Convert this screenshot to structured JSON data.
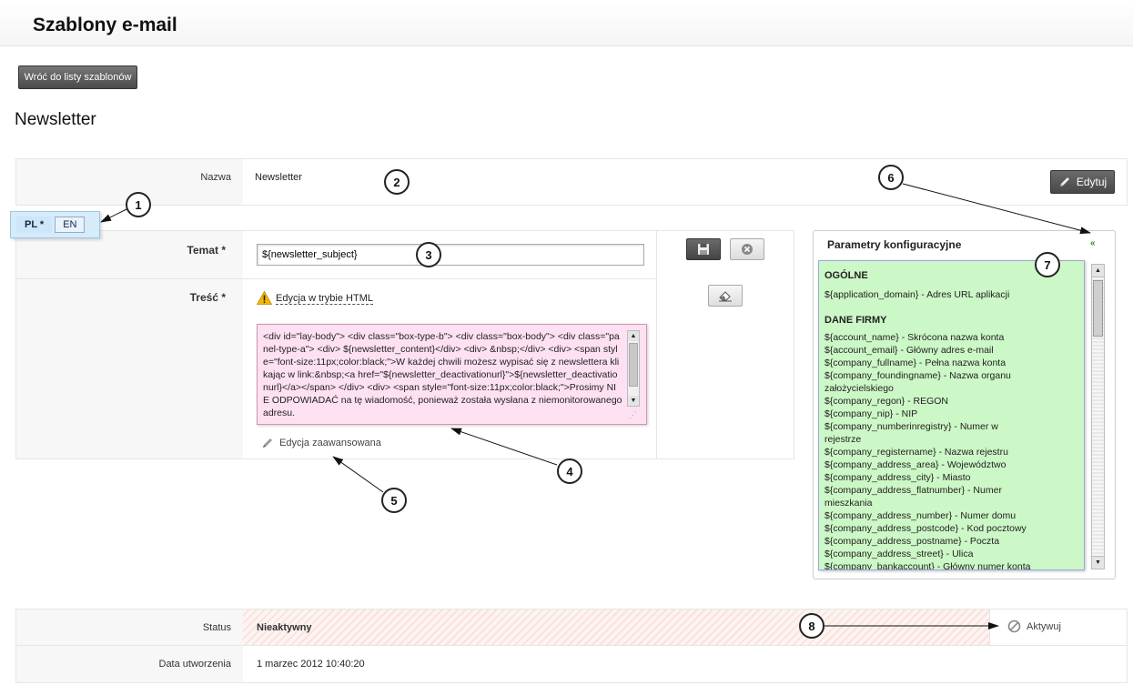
{
  "header": {
    "title": "Szablony e-mail"
  },
  "back_button": {
    "label": "Wróć do listy szablonów"
  },
  "section": {
    "title": "Newsletter"
  },
  "name_row": {
    "label": "Nazwa",
    "value": "Newsletter",
    "edit_label": "Edytuj"
  },
  "lang_tabs": [
    {
      "label": "PL *",
      "active": true
    },
    {
      "label": "EN",
      "active": false
    }
  ],
  "subject": {
    "label": "Temat *",
    "value": "${newsletter_subject}"
  },
  "content": {
    "label": "Treść *",
    "html_mode_label": "Edycja w trybie HTML",
    "editor_text": "<div id=\"lay-body\"> <div class=\"box-type-b\"> <div class=\"box-body\"> <div class=\"panel-type-a\"> <div> ${newsletter_content}</div> <div> &nbsp;</div> <div> <span style=\"font-size:11px;color:black;\">W każdej chwili możesz wypisać się z newslettera klikając w link:&nbsp;<a href=\"${newsletter_deactivationurl}\">${newsletter_deactivationurl}</a></span> </div> <div> <span style=\"font-size:11px;color:black;\">Prosimy NIE ODPOWIADAĆ na tę wiadomość, ponieważ została wysłana z niemonitorowanego adresu.",
    "advanced_label": "Edycja zaawansowana"
  },
  "params": {
    "title": "Parametry konfiguracyjne",
    "general_heading": "OGÓLNE",
    "general_items": [
      "${application_domain} - Adres URL aplikacji"
    ],
    "company_heading": "DANE FIRMY",
    "company_items": [
      "${account_name} - Skrócona nazwa konta",
      "${account_email} - Główny adres e-mail",
      "${company_fullname} - Pełna nazwa konta",
      "${company_foundingname} - Nazwa organu założycielskiego",
      "${company_regon} - REGON",
      "${company_nip} - NIP",
      "${company_numberinregistry} - Numer w rejestrze",
      "${company_registername} - Nazwa rejestru",
      "${company_address_area} - Województwo",
      "${company_address_city} - Miasto",
      "${company_address_flatnumber} - Numer mieszkania",
      "${company_address_number} - Numer domu",
      "${company_address_postcode} - Kod pocztowy",
      "${company_address_postname} - Poczta",
      "${company_address_street} - Ulica",
      "${company_bankaccount} - Główny numer konta bankowego"
    ]
  },
  "status_row": {
    "label": "Status",
    "value": "Nieaktywny",
    "action_label": "Aktywuj"
  },
  "created_row": {
    "label": "Data utworzenia",
    "value": "1 marzec 2012 10:40:20"
  },
  "callouts": {
    "c1": "1",
    "c2": "2",
    "c3": "3",
    "c4": "4",
    "c5": "5",
    "c6": "6",
    "c7": "7",
    "c8": "8"
  }
}
